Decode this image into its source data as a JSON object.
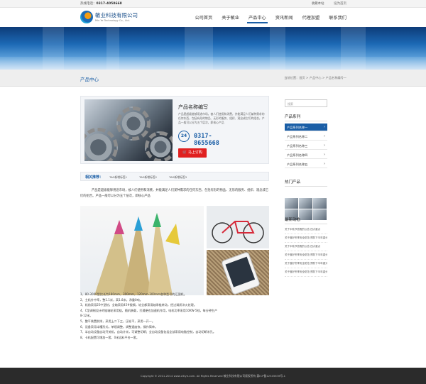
{
  "topbar": {
    "hotline_label": "热线电话：",
    "hotline_number": "0317-4058668",
    "links": [
      "收藏本站",
      "设为首页"
    ]
  },
  "header": {
    "brand_cn": "敏业科技有限公司",
    "brand_en": "Min Ye Technology Co., Ltd.",
    "nav": [
      "公司首页",
      "关于敏业",
      "产品中心",
      "资讯新闻",
      "代理加盟",
      "联系我们"
    ]
  },
  "band": {
    "title": "产品中心",
    "breadcrumb": "当前位置：首页 > 产品中心 > 产品名称编号一"
  },
  "product": {
    "name": "产品名称编写",
    "desc": "产品是超级能够用途市场，被人们使用和消费，并能满足人们某种需求的任何东西，包括有形的物品、无形的服务、组织、观念或它们的组合。产品一般可以分为五个层次，即核心产品",
    "tel": "0317-8655668",
    "tel_badge": "24",
    "buy_label": "马上订购"
  },
  "related": {
    "label": "相关推荐：",
    "tags": [
      "TAG新增标签1",
      "TAG新增标签2",
      "TAG新增标签3"
    ]
  },
  "intro": "产品是超级能够用途市场，被人们使用和消费，并能满足人们某种需求的任何东西，包括有形的物品、无形的服务、组织、观念或它们的组合。产品一般可以分为五个层次，即核心产品",
  "specs": [
    "1、80-3000型比长为180mm，300mm，120mm-300mm各种型号的汇图机。",
    "2、主机外中率，整1.1米，高1.8米，净重0吨。",
    "3、机前采用25中型制，全轴采用45#锻钢，轮全都采用轴承链转动，经过调质淬火处理。",
    "4、C型调制设计的链轴轮采用链，随机装载，打通便也加速机作用，电机功率采用10KW-5档，每分钟生产",
    "8-12米。",
    "5、整平装置前排，采用上二下三，压轮平，采用一开一。",
    "6、设备采用半槽形式，单规调整，调整速度快，操作简单。",
    "7、半自动设备自动开关机，自动计米，可调整切断；全自动设备包括全部采用电脑控制，自动切断米孔。",
    "8、卡机配置可增加一套，0米远料平台一套。"
  ],
  "sidebar": {
    "search_placeholder": "搜索",
    "series_title": "产品系列",
    "series": [
      "产品系列名称一",
      "产品系列名称二",
      "产品系列名称三",
      "产品系列名称四",
      "产品系列名称五"
    ],
    "hot_title": "热门产品",
    "news_title": "最新动态",
    "news": [
      "关于中秋节放假的公告 四大重点",
      "关于做好冬季安全防范 预防下半年重头戏",
      "关于中秋节放假的公告 四大重点",
      "关于做好冬季安全防范 预防下半年重头戏",
      "关于做好冬季安全防范 预防下半年重头戏",
      "关于做好冬季安全防范 预防下半年重头戏"
    ]
  },
  "footer": {
    "copyright": "Copyright © 2011-2014 www.cltiye.com. All Rights Reserved  敏业科技有限公司版权所有 冀ICP备12345678号-1"
  },
  "colors": {
    "accent": "#1a5ea6",
    "buy": "#e02020",
    "footer_bg": "#2b2b2b"
  }
}
